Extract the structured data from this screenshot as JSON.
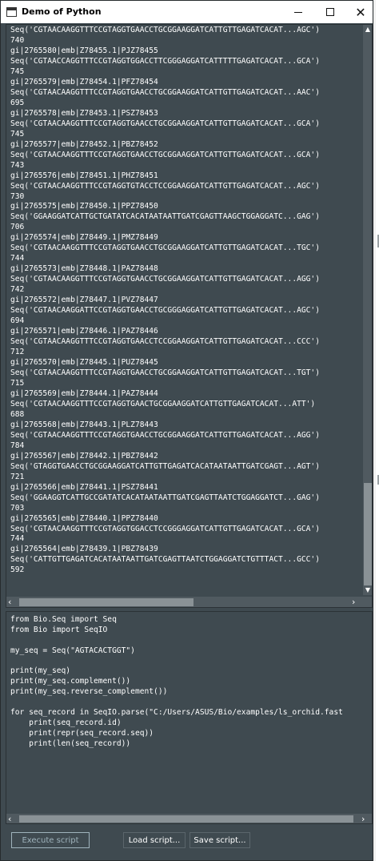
{
  "window": {
    "title": "Demo of Python",
    "minimize_label": "",
    "maximize_label": "",
    "close_label": "✕"
  },
  "output": {
    "lines": [
      "Seq('CGTAACAAGGTTTCCGTAGGTGAACCTGCGGAAGGATCATTGTTGAGATCACAT...AGC')",
      "740",
      "gi|2765580|emb|Z78455.1|PJZ78455",
      "Seq('CGTAACCAGGTTTCCGTAGGTGGACCTTCGGGAGGATCATTTTTGAGATCACAT...GCA')",
      "745",
      "gi|2765579|emb|Z78454.1|PFZ78454",
      "Seq('CGTAACAAGGTTTCCGTAGGTGAACCTGCGGAAGGATCATTGTTGAGATCACAT...AAC')",
      "695",
      "gi|2765578|emb|Z78453.1|PSZ78453",
      "Seq('CGTAACAAGGTTTCCGTAGGTGAACCTGCGGAAGGATCATTGTTGAGATCACAT...GCA')",
      "745",
      "gi|2765577|emb|Z78452.1|PBZ78452",
      "Seq('CGTAACAAGGTTTCCGTAGGTGAACCTGCGGAAGGATCATTGTTGAGATCACAT...GCA')",
      "743",
      "gi|2765576|emb|Z78451.1|PHZ78451",
      "Seq('CGTAACAAGGTTTCCGTAGGTGTACCTCCGGAAGGATCATTGTTGAGATCACAT...AGC')",
      "730",
      "gi|2765575|emb|Z78450.1|PPZ78450",
      "Seq('GGAAGGATCATTGCTGATATCACATAATAATTGATCGAGTTAAGCTGGAGGATC...GAG')",
      "706",
      "gi|2765574|emb|Z78449.1|PMZ78449",
      "Seq('CGTAACAAGGTTTCCGTAGGTGAACCTGCGGAAGGATCATTGTTGAGATCACAT...TGC')",
      "744",
      "gi|2765573|emb|Z78448.1|PAZ78448",
      "Seq('CGTAACAAGGTTTCCGTAGGTGAACCTGCGGAAGGATCATTGTTGAGATCACAT...AGG')",
      "742",
      "gi|2765572|emb|Z78447.1|PVZ78447",
      "Seq('CGTAACAAGGATTCCGTAGGTGAACCTGCGGGAGGATCATTGTTGAGATCACAT...AGC')",
      "694",
      "gi|2765571|emb|Z78446.1|PAZ78446",
      "Seq('CGTAACAAGGTTTCCGTAGGTGAACCTCCGGAAGGATCATTGTTGAGATCACAT...CCC')",
      "712",
      "gi|2765570|emb|Z78445.1|PUZ78445",
      "Seq('CGTAACAAGGTTTCCGTAGGTGAACCTGCGGAAGGATCATTGTTGAGATCACAT...TGT')",
      "715",
      "gi|2765569|emb|Z78444.1|PAZ78444",
      "Seq('CGTAACAAGGTTTCCGTAGGTGAACTGCGGAAGGATCATTGTTGAGATCACAT...ATT')",
      "688",
      "gi|2765568|emb|Z78443.1|PLZ78443",
      "Seq('CGTAACAAGGTTTCCGTAGGTGAACCTGCGGAAGGATCATTGTTGAGATCACAT...AGG')",
      "784",
      "gi|2765567|emb|Z78442.1|PBZ78442",
      "Seq('GTAGGTGAACCTGCGGAAGGATCATTGTTGAGATCACATAATAATTGATCGAGT...AGT')",
      "721",
      "gi|2765566|emb|Z78441.1|PSZ78441",
      "Seq('GGAAGGTCATTGCCGATATCACATAATAATTGATCGAGTTAATCTGGAGGATCT...GAG')",
      "703",
      "gi|2765565|emb|Z78440.1|PPZ78440",
      "Seq('CGTAACAAGGTTTCCGTAGGTGGACCTCCGGGAGGATCATTGTTGAGATCACAT...GCA')",
      "744",
      "gi|2765564|emb|Z78439.1|PBZ78439",
      "Seq('CATTGTTGAGATCACATAATAATTGATCGAGTTAATCTGGAGGATCTGTTTACT...GCC')",
      "592"
    ]
  },
  "script": {
    "lines": [
      "from Bio.Seq import Seq",
      "from Bio import SeqIO",
      "",
      "my_seq = Seq(\"AGTACACTGGT\")",
      "",
      "print(my_seq)",
      "print(my_seq.complement())",
      "print(my_seq.reverse_complement())",
      "",
      "for seq_record in SeqIO.parse(\"C:/Users/ASUS/Bio/examples/ls_orchid.fast",
      "    print(seq_record.id)",
      "    print(repr(seq_record.seq))",
      "    print(len(seq_record))"
    ]
  },
  "buttons": {
    "execute_label": "Execute script",
    "load_label": "Load script...",
    "save_label": "Save script..."
  },
  "scroll": {
    "up_arrow": "▲",
    "down_arrow": "▼",
    "left_arrow": "‹",
    "right_arrow": "›"
  },
  "colors": {
    "panel_bg": "#3f4a50",
    "text": "#ffffff",
    "execute_disabled": "#9fb3bc"
  }
}
